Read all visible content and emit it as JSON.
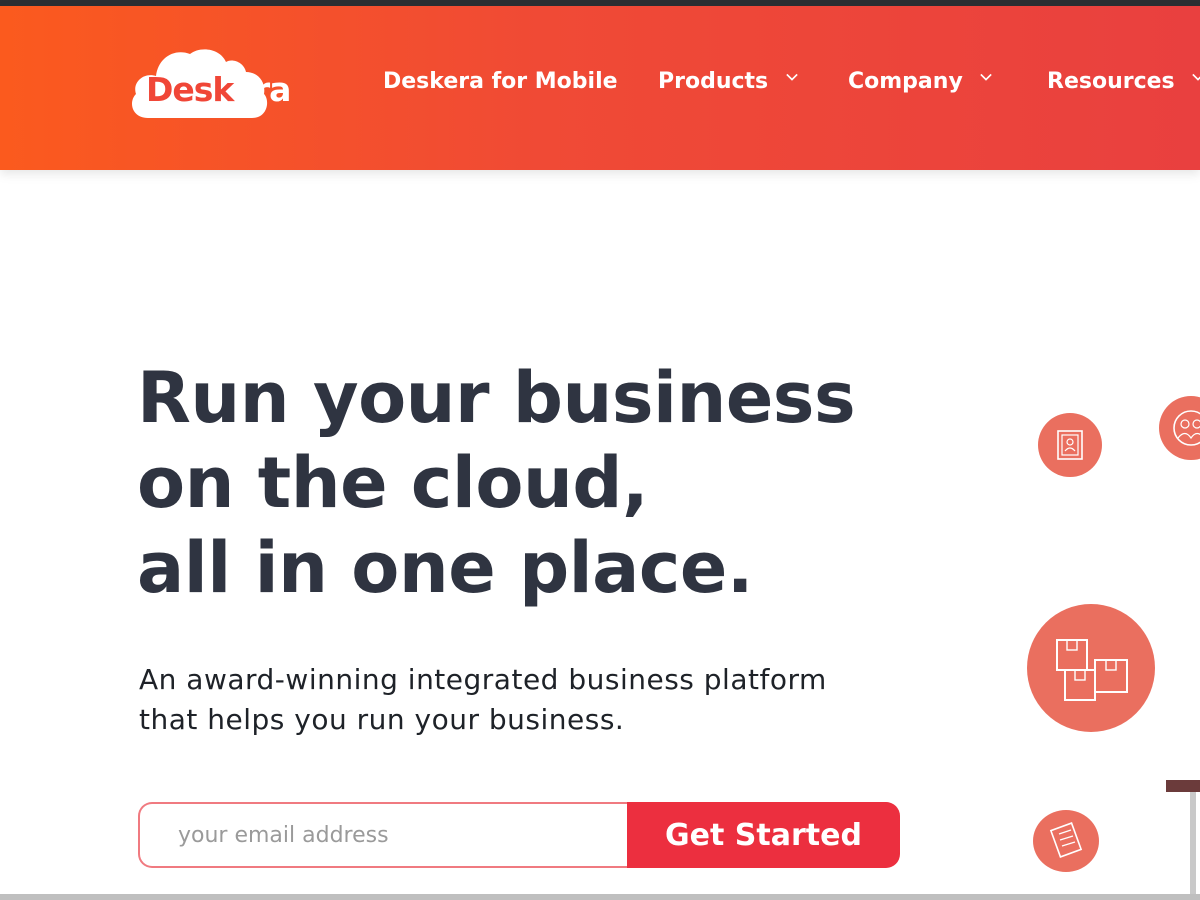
{
  "brand": {
    "logo_part1": "Desk",
    "logo_part2": "era",
    "primary_color": "#f04a35",
    "accent_color": "#ec2f3f",
    "text_color": "#2f3441"
  },
  "nav": {
    "items": [
      {
        "label": "Deskera for Mobile",
        "has_dropdown": false
      },
      {
        "label": "Products",
        "has_dropdown": true,
        "icon": "chevron-down-icon"
      },
      {
        "label": "Company",
        "has_dropdown": true,
        "icon": "chevron-down-icon"
      },
      {
        "label": "Resources",
        "has_dropdown": true,
        "icon": "chevron-down-icon"
      }
    ]
  },
  "hero": {
    "title_lines": [
      "Run your business",
      "on the cloud,",
      "all in one place."
    ],
    "subtitle_lines": [
      "An award-winning integrated business platform",
      "that helps you run your business."
    ]
  },
  "signup": {
    "email_placeholder": "your email address",
    "email_value": "",
    "button_label": "Get Started"
  },
  "illustrations": {
    "icons": [
      "id-card-icon",
      "team-icon",
      "boxes-icon",
      "document-icon"
    ]
  }
}
